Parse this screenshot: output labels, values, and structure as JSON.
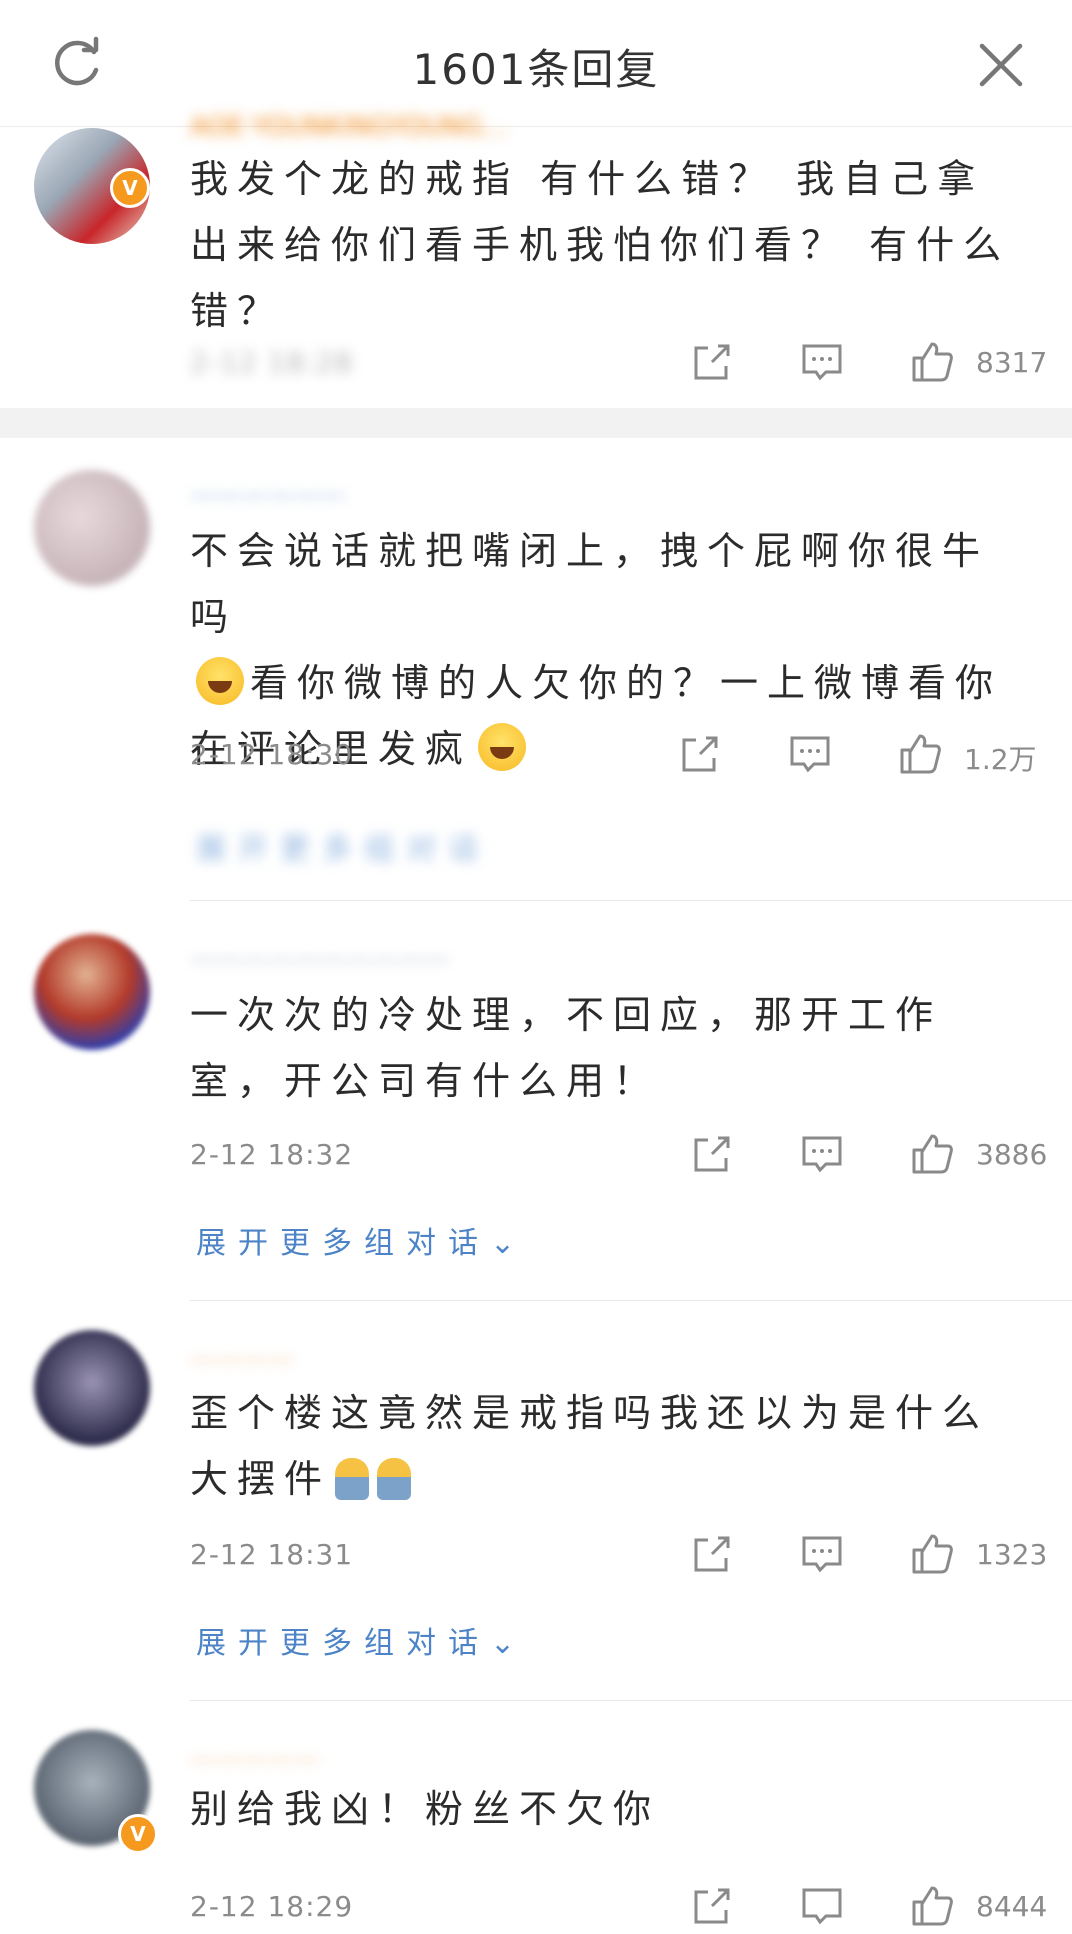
{
  "header": {
    "title": "1601条回复",
    "refresh_icon": "refresh-icon",
    "close_icon": "close-icon"
  },
  "comments": [
    {
      "username": "AOE·YOUNKINGYOUNG…",
      "verified": true,
      "text": "我发个龙的戒指 有什么错？ 我自己拿出来给你们看手机我怕你们看？ 有什么错？",
      "time": "",
      "likes": "8317",
      "expand": ""
    },
    {
      "username": "",
      "verified": false,
      "text_parts": [
        "不会说话就把嘴闭上，拽个屁啊你很牛吗",
        "看你微博的人欠你的？一上微博看你在评论里发疯"
      ],
      "time": "2-12 18:30",
      "likes": "1.2万",
      "expand": "展开更多组对话"
    },
    {
      "username": "",
      "verified": false,
      "text": "一次次的冷处理，不回应，那开工作室，开公司有什么用！",
      "time": "2-12 18:32",
      "likes": "3886",
      "expand": "展开更多组对话"
    },
    {
      "username": "",
      "verified": false,
      "text": "歪个楼这竟然是戒指吗我还以为是什么大摆件",
      "time": "2-12 18:31",
      "likes": "1323",
      "expand": "展开更多组对话"
    },
    {
      "username": "",
      "verified": true,
      "text": "别给我凶！粉丝不欠你",
      "time": "2-12 18:29",
      "likes": "8444",
      "expand": ""
    }
  ],
  "colors": {
    "link": "#4d84c7",
    "meta": "#8b8b8b",
    "badge": "#f59a1e"
  },
  "icons": {
    "share": "share-icon",
    "comment": "comment-icon",
    "like": "thumbs-up-icon"
  }
}
